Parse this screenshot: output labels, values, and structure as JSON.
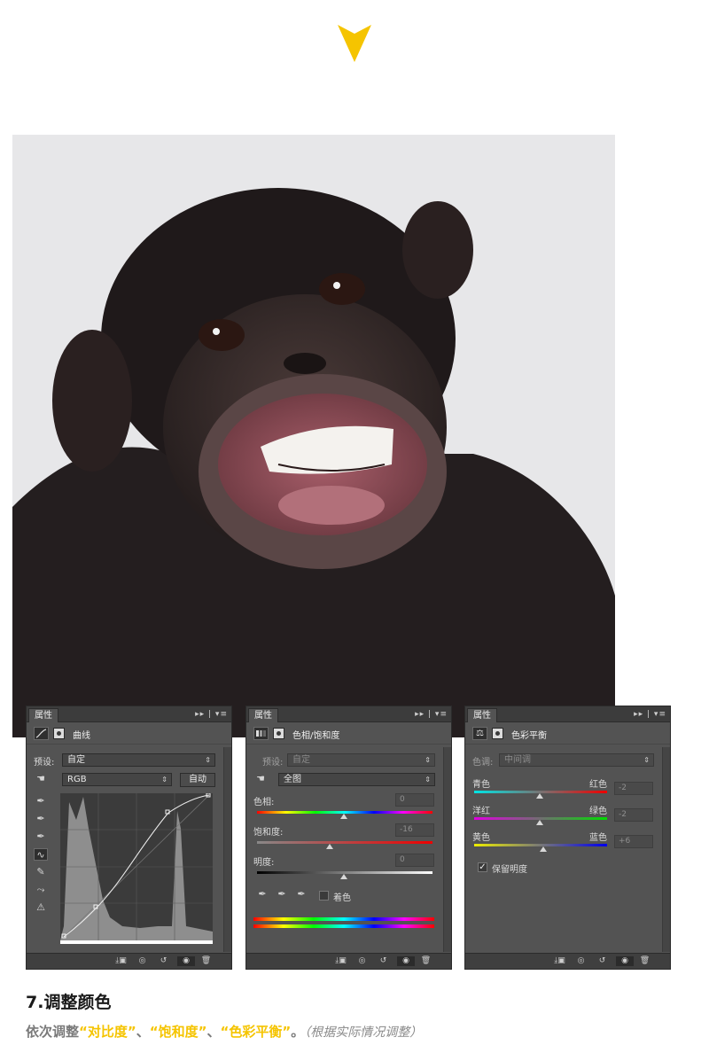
{
  "panels": {
    "curves": {
      "tab": "属性",
      "title": "曲线",
      "preset_label": "预设:",
      "preset_value": "自定",
      "channel_value": "RGB",
      "auto_button": "自动"
    },
    "hue_sat": {
      "tab": "属性",
      "title": "色相/饱和度",
      "preset_label": "预设:",
      "preset_value": "自定",
      "range_value": "全图",
      "hue_label": "色相:",
      "hue_value": "0",
      "saturation_label": "饱和度:",
      "saturation_value": "-16",
      "lightness_label": "明度:",
      "lightness_value": "0",
      "colorize_label": "着色"
    },
    "color_balance": {
      "tab": "属性",
      "title": "色彩平衡",
      "tone_label": "色调:",
      "tone_value": "中间调",
      "cyan_label": "青色",
      "red_label": "红色",
      "cyan_red_value": "-2",
      "magenta_label": "洋红",
      "green_label": "绿色",
      "magenta_green_value": "-2",
      "yellow_label": "黄色",
      "blue_label": "蓝色",
      "yellow_blue_value": "+6",
      "preserve_label": "保留明度"
    }
  },
  "step": {
    "heading": "7.调整颜色",
    "prefix": "依次调整",
    "item1": "“对比度”",
    "sep1": "、",
    "item2": "“饱和度”",
    "sep2": "、",
    "item3": "“色彩平衡”",
    "end": "。",
    "note": "（根据实际情况调整）"
  },
  "colors": {
    "accent": "#f5c400",
    "panel_bg": "#535353"
  }
}
